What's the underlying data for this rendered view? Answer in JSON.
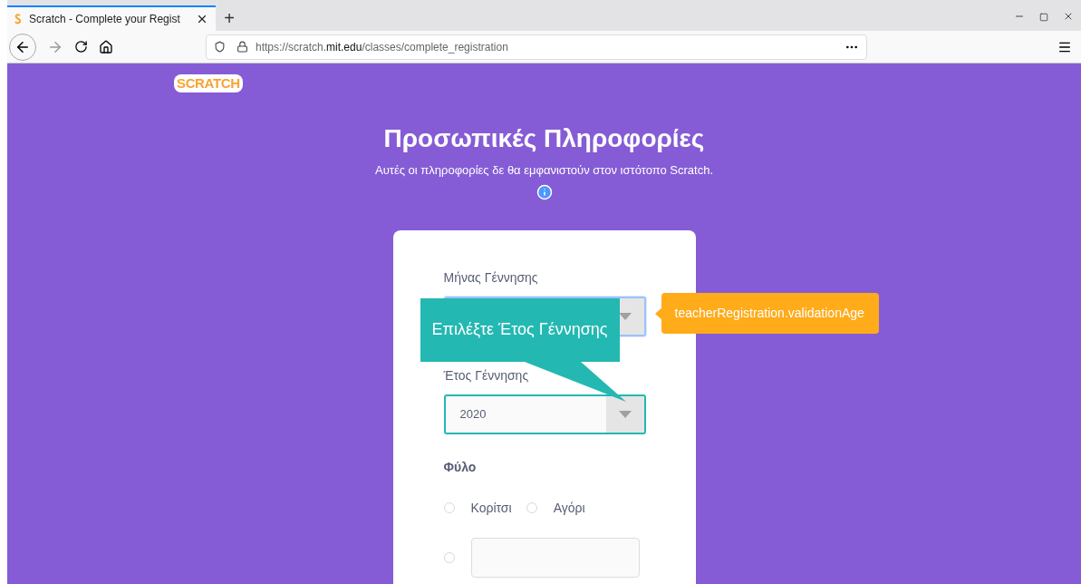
{
  "browser": {
    "tabs": [
      {
        "title": "Scratch - Complete your Regist",
        "selected": true
      }
    ],
    "new_tab": "+",
    "url": {
      "prefix": "https://scratch.",
      "domain": "mit.edu",
      "path": "/classes/complete_registration"
    }
  },
  "page": {
    "logo": "SCRATCH",
    "title": "Προσωπικές Πληροφορίες",
    "subtitle": "Αυτές οι πληροφορίες δε θα εμφανιστούν στον ιστότοπο Scratch.",
    "fields": [
      {
        "label": "Μήνας Γέννησης",
        "focused": true,
        "highlighted": false
      },
      {
        "label": "Έτος Γέννησης",
        "value": "2020",
        "focused": false,
        "highlighted": true
      }
    ],
    "gender": {
      "label": "Φύλο",
      "options": [
        {
          "label": "Κορίτσι",
          "selected": false
        },
        {
          "label": "Αγόρι",
          "selected": false
        }
      ],
      "other": {
        "selected": false
      }
    },
    "validation_tooltip": "teacherRegistration.validationAge"
  },
  "callout": "Επιλέξτε Έτος Γέννησης"
}
